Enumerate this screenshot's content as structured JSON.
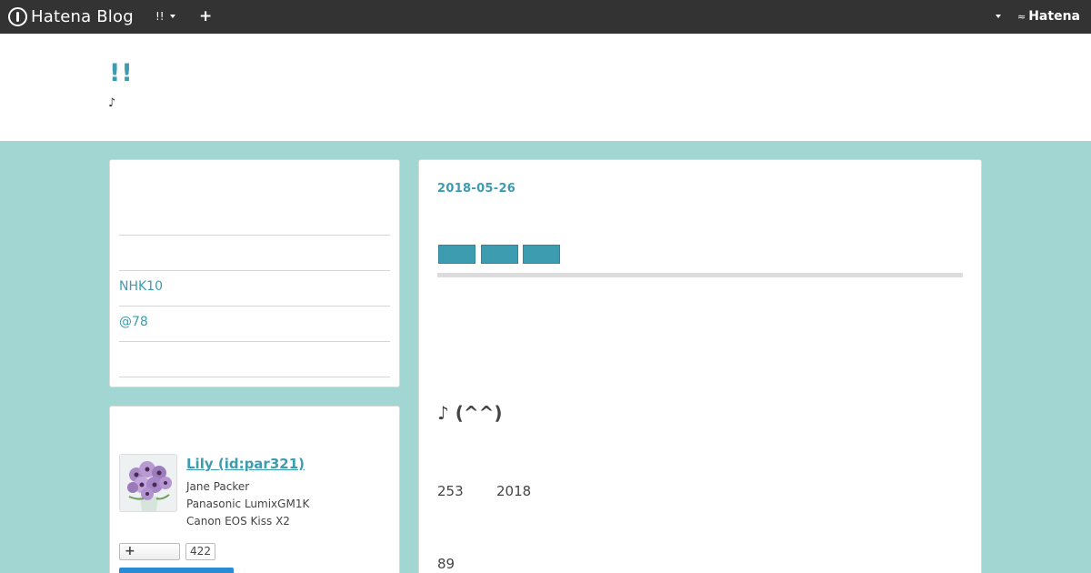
{
  "topbar": {
    "logo_text": "Hatena Blog",
    "blog_menu_label": "!!",
    "add_label": "+",
    "hatena_logo_text": "Hatena"
  },
  "header": {
    "blog_title": "!!",
    "description": "♪"
  },
  "sidebar": {
    "links": [
      "NHK10",
      "@78"
    ]
  },
  "profile": {
    "name": "Lily (id:par321)",
    "lines": [
      "Jane Packer",
      "Panasonic LumixGM1K",
      "Canon EOS Kiss X2"
    ],
    "follow_label": "+",
    "follow_count": "422"
  },
  "article": {
    "date": "2018-05-26",
    "category_count": 3,
    "headline": "♪ (^^)",
    "numbers": [
      "253",
      "2018",
      "89"
    ]
  },
  "colors": {
    "accent": "#3d9cb0",
    "background": "#a2d6d2",
    "topbar": "#333333"
  }
}
